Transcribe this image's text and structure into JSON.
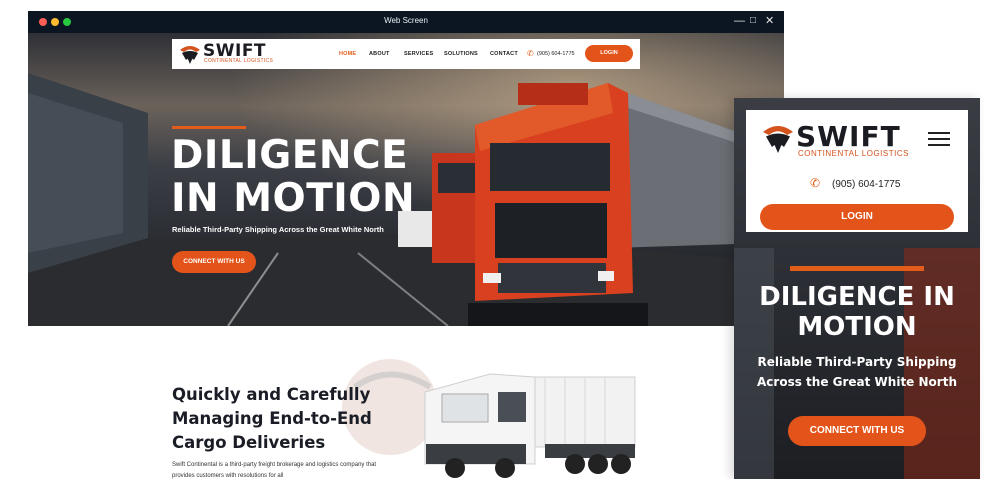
{
  "window": {
    "title": "Web Screen"
  },
  "desktop": {
    "nav": {
      "logo_word": "SWIFT",
      "logo_sub": "CONTINENTAL LOGISTICS",
      "items": [
        "HOME",
        "ABOUT",
        "SERVICES",
        "SOLUTIONS",
        "CONTACT"
      ],
      "active": "HOME",
      "phone": "(905) 604-1775",
      "login": "LOGIN"
    },
    "hero": {
      "title_line1": "DILIGENCE",
      "title_line2": "IN MOTION",
      "subtitle": "Reliable Third-Party Shipping Across the Great White North",
      "cta": "CONNECT WITH US"
    },
    "about": {
      "title": "Quickly and Carefully Managing End-to-End Cargo Deliveries",
      "description": "Swift Continental is a third-party freight brokerage and logistics company that provides customers with resolutions for all"
    }
  },
  "mobile": {
    "logo_word": "SWIFT",
    "logo_sub": "CONTINENTAL LOGISTICS",
    "phone": "(905) 604-1775",
    "login": "LOGIN",
    "title": "DILIGENCE IN MOTION",
    "subtitle": "Reliable Third-Party Shipping Across the Great White North",
    "cta": "CONNECT WITH US"
  },
  "colors": {
    "accent": "#e3541a",
    "titlebar": "#0b1622",
    "heading": "#1a1d26"
  }
}
